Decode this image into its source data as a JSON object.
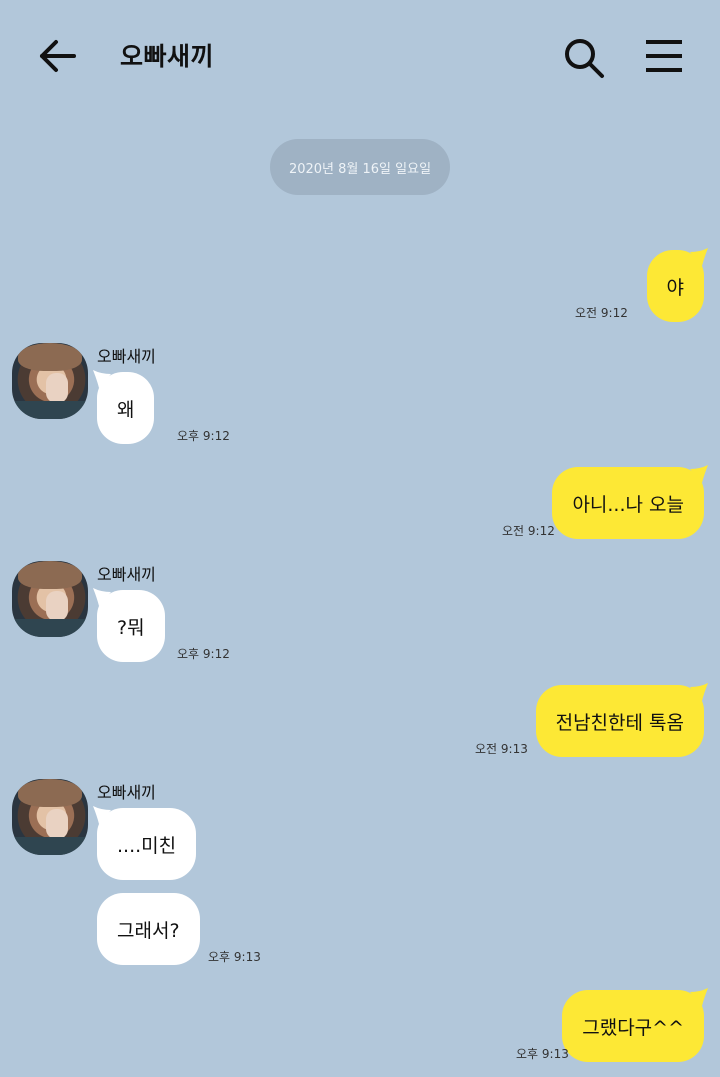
{
  "header": {
    "title": "오빠새끼",
    "back_icon": "arrow-left-icon",
    "search_icon": "search-icon",
    "menu_icon": "hamburger-menu-icon"
  },
  "date_divider": "2020년 8월 16일 일요일",
  "colors": {
    "background": "#b2c7da",
    "my_bubble": "#fde835",
    "their_bubble": "#ffffff"
  },
  "messages": [
    {
      "from": "me",
      "text": "야",
      "time": "오전 9:12"
    },
    {
      "from": "them",
      "sender": "오빠새끼",
      "text": "왜",
      "time": "오후 9:12"
    },
    {
      "from": "me",
      "text": "아니...나 오늘",
      "time": "오전 9:12"
    },
    {
      "from": "them",
      "sender": "오빠새끼",
      "text": "?뭐",
      "time": "오후 9:12"
    },
    {
      "from": "me",
      "text": "전남친한테 톡옴",
      "time": "오전 9:13"
    },
    {
      "from": "them",
      "sender": "오빠새끼",
      "text": "....미친",
      "time": ""
    },
    {
      "from": "them",
      "text": "그래서?",
      "time": "오후 9:13"
    },
    {
      "from": "me",
      "text": "그랬다구^^",
      "time": "오후 9:13"
    }
  ]
}
